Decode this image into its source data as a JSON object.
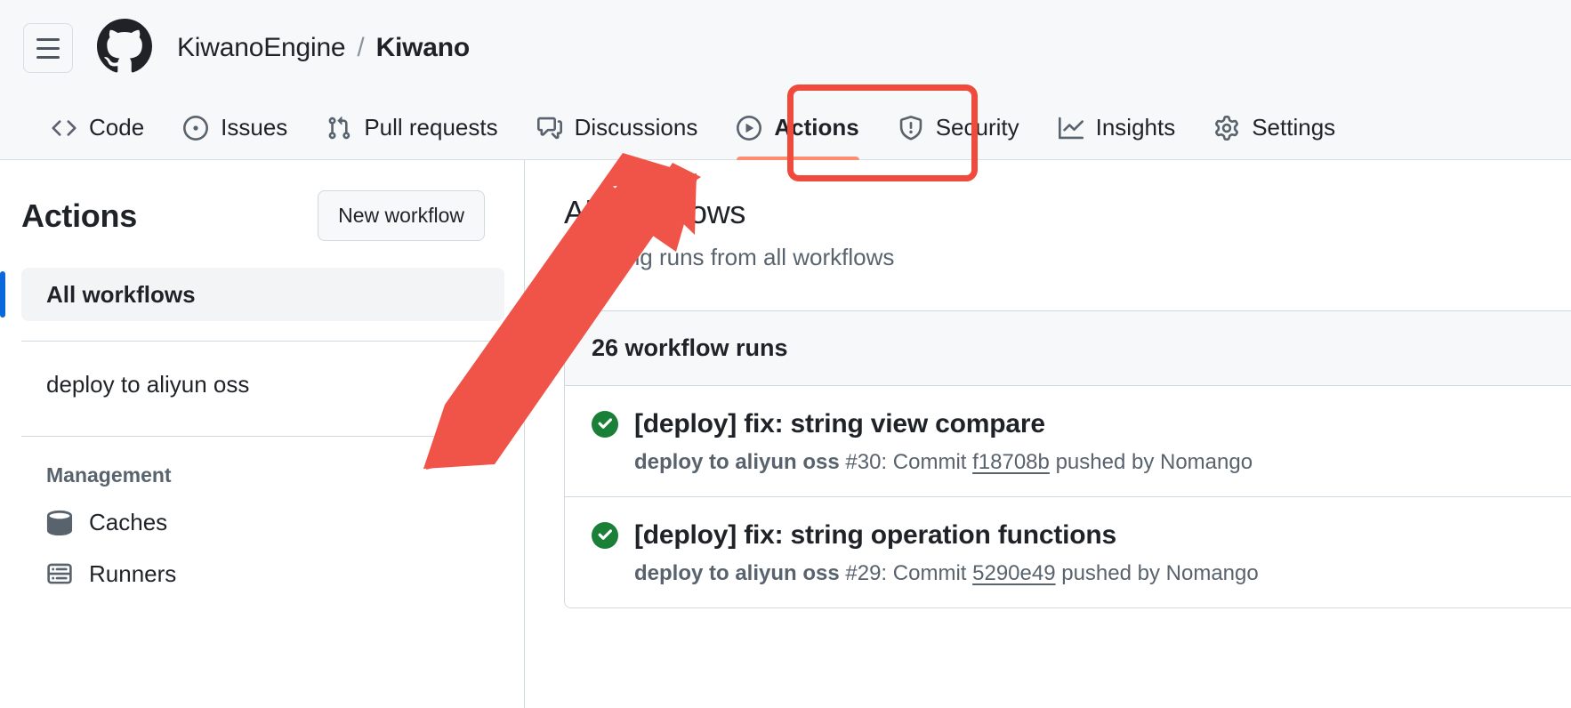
{
  "header": {
    "menu_icon": "hamburger-menu-icon",
    "logo_icon": "github-logo-icon",
    "owner": "KiwanoEngine",
    "separator": "/",
    "repo": "Kiwano"
  },
  "nav": {
    "tabs": [
      {
        "label": "Code",
        "icon": "code-icon",
        "active": false
      },
      {
        "label": "Issues",
        "icon": "issue-opened-icon",
        "active": false
      },
      {
        "label": "Pull requests",
        "icon": "git-pull-request-icon",
        "active": false
      },
      {
        "label": "Discussions",
        "icon": "comment-discussion-icon",
        "active": false
      },
      {
        "label": "Actions",
        "icon": "play-circle-icon",
        "active": true
      },
      {
        "label": "Security",
        "icon": "shield-alert-icon",
        "active": false
      },
      {
        "label": "Insights",
        "icon": "graph-icon",
        "active": false
      },
      {
        "label": "Settings",
        "icon": "gear-icon",
        "active": false
      }
    ],
    "active_underline_color": "#fd8c73"
  },
  "annotation": {
    "highlight_color": "#ef4a3c",
    "highlight_target": "Actions",
    "arrow_color": "#f05449"
  },
  "sidebar": {
    "title": "Actions",
    "new_workflow_label": "New workflow",
    "workflows": [
      {
        "label": "All workflows",
        "active": true
      },
      {
        "label": "deploy to aliyun oss",
        "active": false
      }
    ],
    "management_label": "Management",
    "management_items": [
      {
        "label": "Caches",
        "icon": "cache-database-icon"
      },
      {
        "label": "Runners",
        "icon": "server-rack-icon"
      }
    ],
    "active_indicator_color": "#0969da"
  },
  "main": {
    "title": "All workflows",
    "subtitle": "Showing runs from all workflows",
    "runs_count_label": "26 workflow runs",
    "runs": [
      {
        "status": "success",
        "status_icon": "check-circle-icon",
        "status_color": "#1a7f37",
        "title": "[deploy] fix: string view compare",
        "workflow_name": "deploy to aliyun oss",
        "run_number": "#30:",
        "commit_word": "Commit",
        "commit_sha": "f18708b",
        "pushed_by": "pushed by Nomango"
      },
      {
        "status": "success",
        "status_icon": "check-circle-icon",
        "status_color": "#1a7f37",
        "title": "[deploy] fix: string operation functions",
        "workflow_name": "deploy to aliyun oss",
        "run_number": "#29:",
        "commit_word": "Commit",
        "commit_sha": "5290e49",
        "pushed_by": "pushed by Nomango"
      }
    ]
  }
}
